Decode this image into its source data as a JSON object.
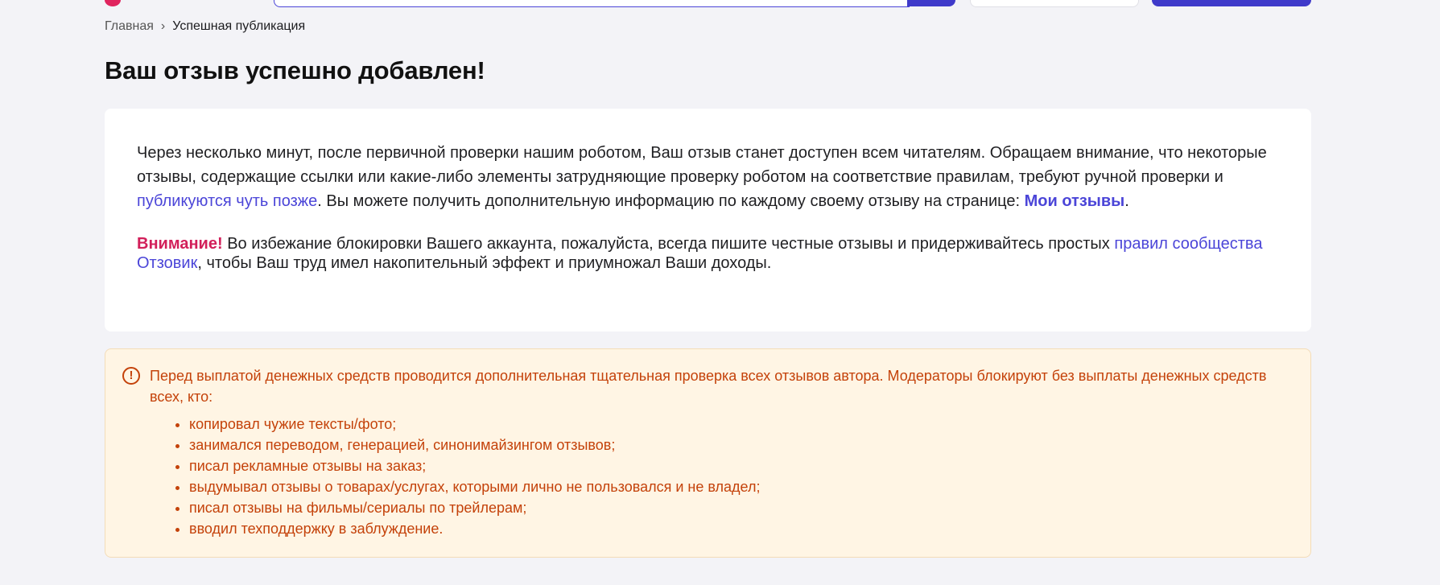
{
  "breadcrumb": {
    "home": "Главная",
    "separator": "›",
    "current": "Успешная публикация"
  },
  "page": {
    "title": "Ваш отзыв успешно добавлен!"
  },
  "info": {
    "text1": "Через несколько минут, после первичной проверки нашим роботом, Ваш отзыв станет доступен всем читателям. Обращаем внимание, что некоторые отзывы, содержащие ссылки или какие-либо элементы затрудняющие проверку роботом на соответствие правилам, требуют ручной проверки и ",
    "link_later": "публикуются чуть позже",
    "text2": ". Вы можете получить дополнительную информацию по каждому своему отзыву на странице: ",
    "link_my_reviews": "Мои отзывы",
    "text3": ".",
    "attention_label": "Внимание!",
    "text4": " Во избежание блокировки Вашего аккаунта, пожалуйста, всегда пишите честные отзывы и придерживайтесь простых ",
    "link_rules": "правил сообщества Отзовик",
    "text5": ", чтобы Ваш труд имел накопительный эффект и приумножал Ваши доходы."
  },
  "alert": {
    "icon": "exclamation-circle-icon",
    "icon_glyph": "!",
    "text": "Перед выплатой денежных средств проводится дополнительная тщательная проверка всех отзывов автора. Модераторы блокируют без выплаты денежных средств всех, кто:",
    "items": [
      "копировал чужие тексты/фото;",
      "занимался переводом, генерацией, синонимайзингом отзывов;",
      "писал рекламные отзывы на заказ;",
      "выдумывал отзывы о товарах/услугах, которыми лично не пользовался и не владел;",
      "писал отзывы на фильмы/сериалы по трейлерам;",
      "вводил техподдержку в заблуждение."
    ]
  },
  "colors": {
    "accent": "#4b45d8",
    "attention": "#d21f5a",
    "alert_text": "#c4420a",
    "alert_bg": "#fff5e4",
    "page_bg": "#f3f3f7"
  }
}
